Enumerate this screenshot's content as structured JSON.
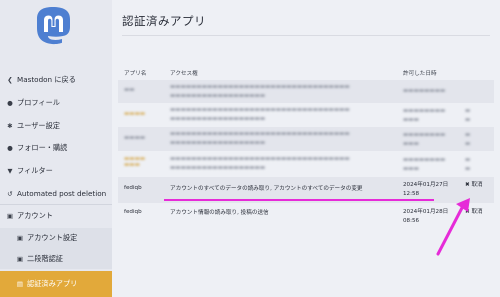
{
  "sidebar": {
    "items": [
      {
        "icon": "chevron-left-icon",
        "glyph": "❮",
        "label": "Mastodon に戻る"
      },
      {
        "icon": "user-icon",
        "glyph": "●",
        "label": "プロフィール"
      },
      {
        "icon": "gear-icon",
        "glyph": "✱",
        "label": "ユーザー設定"
      },
      {
        "icon": "users-icon",
        "glyph": "●",
        "label": "フォロー・購読"
      },
      {
        "icon": "filter-icon",
        "glyph": "▼",
        "label": "フィルター"
      },
      {
        "icon": "history-icon",
        "glyph": "↺",
        "label": "Automated post deletion"
      },
      {
        "icon": "lock-icon",
        "glyph": "▣",
        "label": "アカウント"
      },
      {
        "icon": "lock-icon",
        "glyph": "▣",
        "label": "アカウント設定"
      },
      {
        "icon": "lock-icon",
        "glyph": "▣",
        "label": "二段階認証"
      },
      {
        "icon": "list-icon",
        "glyph": "▤",
        "label": "認証済みアプリ"
      }
    ]
  },
  "main": {
    "title": "認証済みアプリ",
    "columns": [
      "アプリ名",
      "アクセス権",
      "許可した日時"
    ],
    "rows": [
      {
        "app": "fediqb",
        "access": "アカウントのすべてのデータの読み取り, アカウントのすべてのデータの変更",
        "date": "2024年01月27日",
        "time": "12:58",
        "revoke": "✖ 取消"
      },
      {
        "app": "fediqb",
        "access": "アカウント情報の読み取り, 投稿の送信",
        "date": "2024年01月28日",
        "time": "08:56",
        "revoke": "✖ 取消"
      }
    ]
  },
  "colors": {
    "accent": "#e2a93a",
    "highlight": "#e62bd8"
  }
}
